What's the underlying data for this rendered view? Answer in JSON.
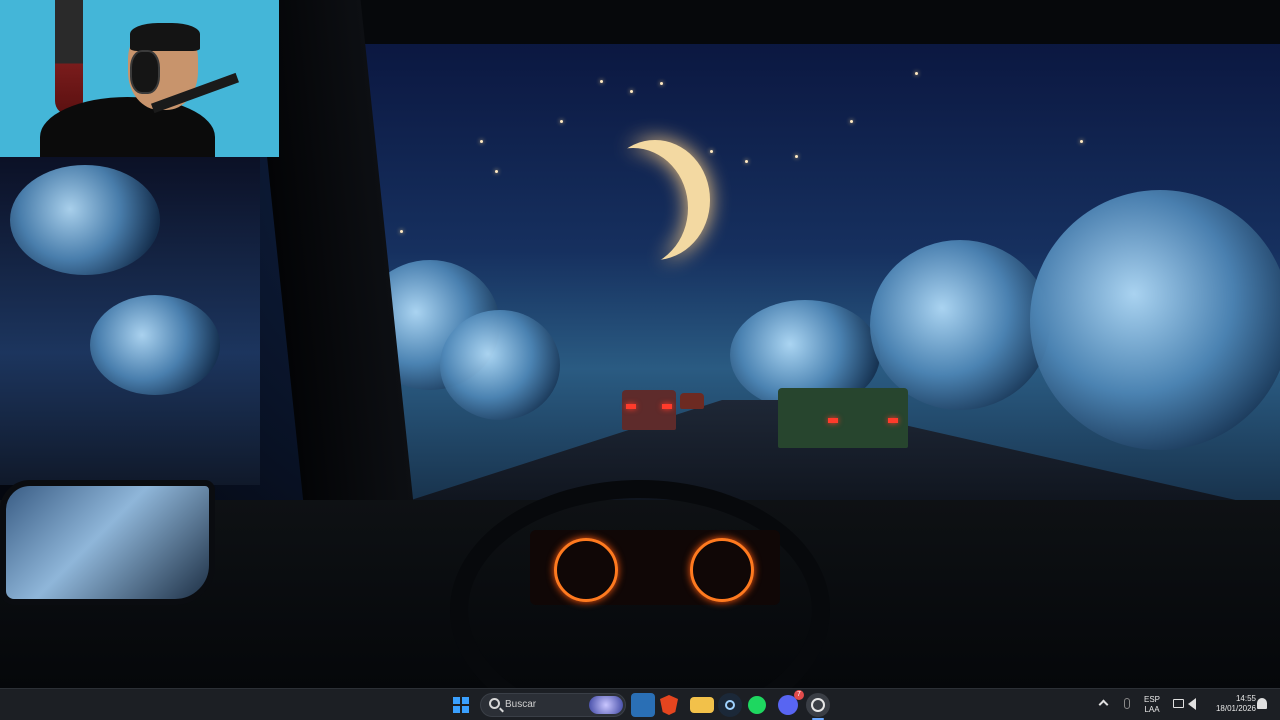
{
  "webcam": {
    "label": ""
  },
  "taskbar": {
    "search_placeholder": "Buscar",
    "apps": [
      "start",
      "search",
      "photos",
      "brave",
      "file-explorer",
      "steam",
      "spotify",
      "discord",
      "obs"
    ],
    "discord_badge": "7"
  },
  "tray": {
    "language_line1": "ESP",
    "language_line2": "LAA",
    "time": "14:55",
    "date": "18/01/2026"
  }
}
